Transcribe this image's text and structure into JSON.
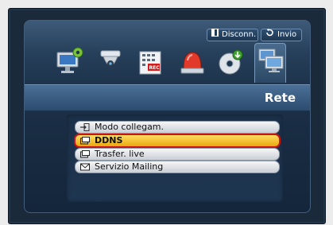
{
  "header": {
    "disconnect_label": "Disconn.",
    "exit_label": "Invio"
  },
  "toolbar": {
    "icons": [
      "monitor-settings-icon",
      "dome-camera-icon",
      "recording-icon",
      "alarm-siren-icon",
      "disc-backup-icon",
      "network-icon"
    ],
    "selected_icon": "network-icon"
  },
  "page": {
    "title": "Rete"
  },
  "menu": {
    "items": [
      {
        "label": "Modo collegam.",
        "icon": "connection-mode-icon"
      },
      {
        "label": "DDNS",
        "icon": "ddns-icon"
      },
      {
        "label": "Trasfer. live",
        "icon": "live-transfer-icon"
      },
      {
        "label": "Servizio Mailing",
        "icon": "mail-icon"
      }
    ],
    "selected_index": 1
  },
  "colors": {
    "accent_selected": "#f2c330",
    "selection_border": "#c81414",
    "title_band": "#3b5e85"
  }
}
